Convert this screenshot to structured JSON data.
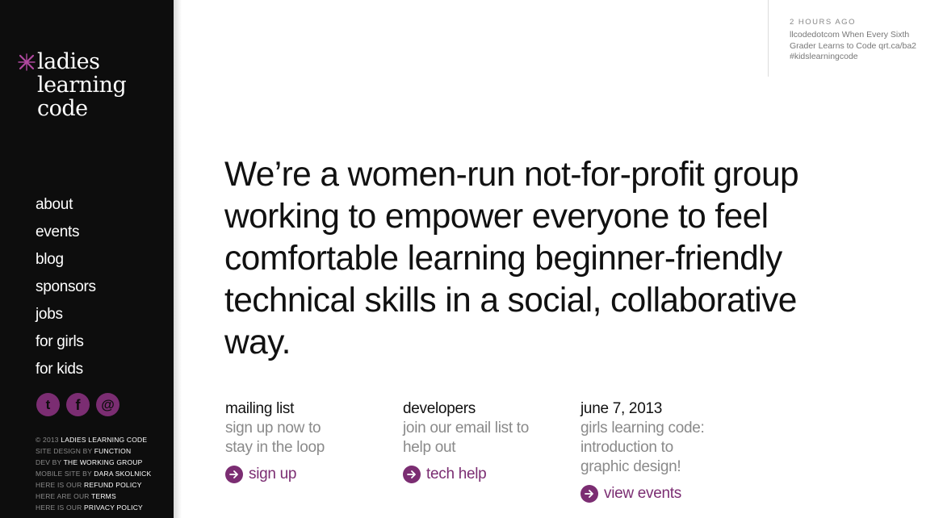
{
  "logo": {
    "lines": [
      "ladies",
      "learning",
      "code"
    ]
  },
  "nav": {
    "items": [
      {
        "label": "about"
      },
      {
        "label": "events"
      },
      {
        "label": "blog"
      },
      {
        "label": "sponsors"
      },
      {
        "label": "jobs"
      },
      {
        "label": "for girls"
      },
      {
        "label": "for kids"
      }
    ]
  },
  "social": {
    "icons": [
      "twitter-icon",
      "facebook-icon",
      "email-icon"
    ],
    "twitter_glyph": "t",
    "facebook_glyph": "f",
    "email_glyph": "@"
  },
  "credits": {
    "copyright_prefix": "© 2013",
    "copyright_name": "LADIES LEARNING CODE",
    "design_prefix": "SITE DESIGN BY",
    "design_name": "FUNCTION",
    "dev_prefix": "DEV BY",
    "dev_name": "THE WORKING GROUP",
    "mobile_prefix": "MOBILE SITE BY",
    "mobile_name": "DARA SKOLNICK",
    "refund_prefix": "HERE IS OUR",
    "refund_name": "REFUND POLICY",
    "terms_prefix": "HERE ARE OUR",
    "terms_name": "TERMS",
    "privacy_prefix": "HERE IS OUR",
    "privacy_name": "PRIVACY POLICY"
  },
  "tweet": {
    "time": "2 HOURS AGO",
    "text": "llcodedotcom When Every Sixth Grader Learns to Code qrt.ca/ba2 #kidslearningcode"
  },
  "headline": "We’re a women-run not-for-profit group working to empower everyone to feel comfortable learning beginner-friendly technical skills in a social, collaborative way.",
  "columns": [
    {
      "title": "mailing list",
      "desc": "sign up now to stay in the loop",
      "cta": "sign up"
    },
    {
      "title": "developers",
      "desc": "join our email list to help out",
      "cta": "tech help"
    },
    {
      "title": "june 7, 2013",
      "desc": "girls learning code: introduction to graphic design!",
      "cta": "view events"
    }
  ],
  "colors": {
    "accent": "#7b2d72",
    "sidebar_bg": "#0d0d0d",
    "logo_mark": "#b0489f"
  }
}
